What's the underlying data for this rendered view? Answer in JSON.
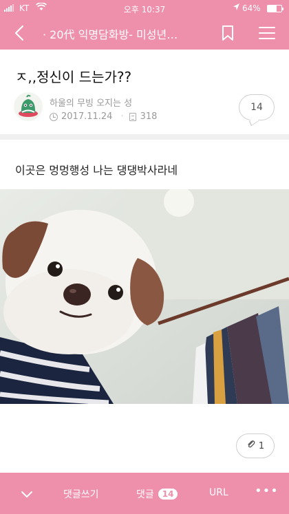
{
  "status_bar": {
    "carrier": "KT",
    "time": "오후 10:37",
    "battery": "64%",
    "battery_level": 0.64
  },
  "nav": {
    "title": "· 20代 익명담화방- 미성년…",
    "icons": [
      "back-arrow-icon",
      "bookmark-icon",
      "hamburger-menu-icon"
    ]
  },
  "post": {
    "title": "ㅈ,,정신이 드는가??",
    "author": "하울의 무빙 오지는 성",
    "date": "2017.11.24",
    "views": "318",
    "comment_count": "14",
    "body": "이곳은 멍멍행성 나는 댕댕박사라네",
    "photo_alt": "dog photo",
    "attachments": "1"
  },
  "toolbar": {
    "write_comment": "댓글쓰기",
    "comments": "댓글",
    "comments_count": "14",
    "url": "URL",
    "more": "•••"
  },
  "colors": {
    "accent": "#ee8fab"
  }
}
